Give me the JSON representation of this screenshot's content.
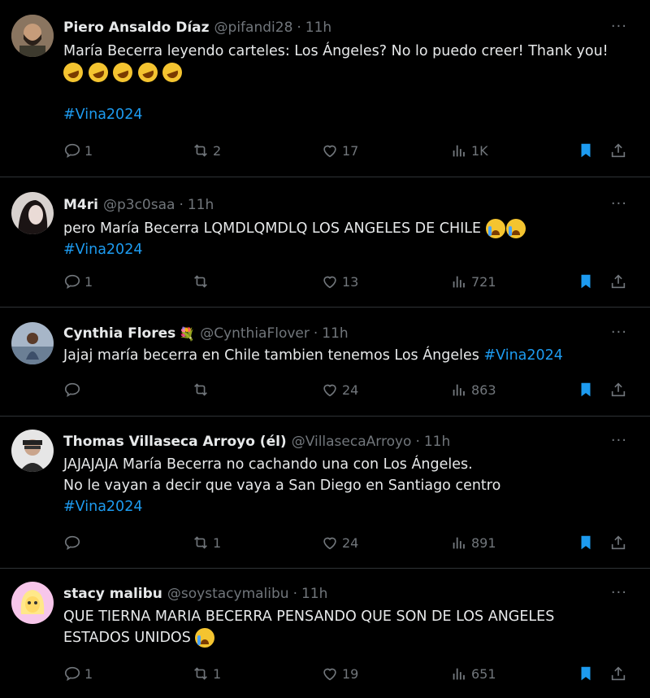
{
  "tweets": [
    {
      "name": "Piero Ansaldo Díaz",
      "badge": "",
      "handle": "@pifandi28",
      "time": "11h",
      "lines": [
        "María Becerra leyendo carteles: Los Ángeles? No lo puedo creer! Thank you!"
      ],
      "emojis": [
        "rofl",
        "rofl",
        "rofl",
        "rofl",
        "rofl"
      ],
      "hashtag": "#Vina2024",
      "reply": "1",
      "retweet": "2",
      "like": "17",
      "views": "1K",
      "avatar_color": "#6b5a4a"
    },
    {
      "name": "M4ri",
      "badge": "",
      "handle": "@p3c0saa",
      "time": "11h",
      "lines": [
        "pero María Becerra LQMDLQMDLQ LOS ANGELES DE CHILE"
      ],
      "emojis": [
        "sob",
        "sob"
      ],
      "hashtag": "#Vina2024",
      "reply": "1",
      "retweet": "",
      "like": "13",
      "views": "721",
      "avatar_color": "#3a2f2f"
    },
    {
      "name": "Cynthia Flores",
      "badge": "💐",
      "handle": "@CynthiaFlover",
      "time": "11h",
      "lines": [
        "Jajaj maría becerra en Chile tambien tenemos Los Ángeles"
      ],
      "emojis": [],
      "hashtag": "#Vina2024",
      "reply": "",
      "retweet": "",
      "like": "24",
      "views": "863",
      "avatar_color": "#7d8aa0"
    },
    {
      "name": "Thomas Villaseca Arroyo (él)",
      "badge": "",
      "handle": "@VillasecaArroyo",
      "time": "11h",
      "lines": [
        "JAJAJAJA María Becerra no cachando una con Los Ángeles.",
        "No le vayan a decir que vaya a San Diego en Santiago centro"
      ],
      "emojis": [],
      "hashtag": "#Vina2024",
      "reply": "",
      "retweet": "1",
      "like": "24",
      "views": "891",
      "avatar_color": "#cfcfcf"
    },
    {
      "name": "stacy malibu",
      "badge": "",
      "handle": "@soystacymalibu",
      "time": "11h",
      "lines": [
        "QUE TIERNA MARIA BECERRA PENSANDO QUE SON DE LOS ANGELES",
        "ESTADOS UNIDOS"
      ],
      "emojis": [
        "sob"
      ],
      "hashtag": "",
      "reply": "1",
      "retweet": "1",
      "like": "19",
      "views": "651",
      "avatar_color": "#f2b6e0"
    }
  ],
  "colors": {
    "accent": "#1d9bf0",
    "muted": "#71767b",
    "text": "#e7e9ea",
    "divider": "#2f3336"
  }
}
